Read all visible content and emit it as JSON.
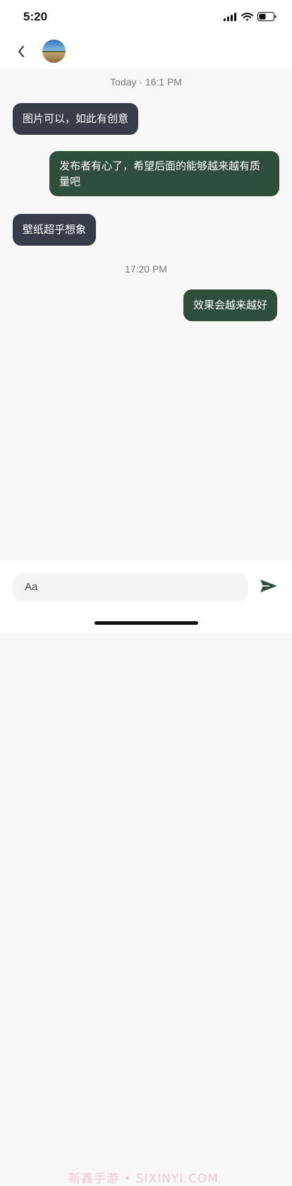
{
  "status_bar": {
    "time": "5:20"
  },
  "header": {
    "avatar_icon": "avatar-landscape"
  },
  "messages": [
    {
      "type": "timestamp",
      "text": "Today · 16:1 PM"
    },
    {
      "type": "bubble",
      "direction": "incoming",
      "text": "图片可以，如此有创意"
    },
    {
      "type": "bubble",
      "direction": "outgoing",
      "text": "发布者有心了，希望后面的能够越来越有质量吧"
    },
    {
      "type": "bubble",
      "direction": "incoming",
      "text": "壁纸超乎想象"
    },
    {
      "type": "timestamp",
      "text": "17:20 PM"
    },
    {
      "type": "bubble",
      "direction": "outgoing",
      "text": "效果会越来越好"
    }
  ],
  "composer": {
    "placeholder": "Aa",
    "send_icon": "send-icon"
  },
  "watermark": "新鑫手游 • SIXINYI.COM",
  "colors": {
    "incoming": "#363c48",
    "outgoing": "#2e4d3b",
    "background": "#f8f8f8"
  }
}
